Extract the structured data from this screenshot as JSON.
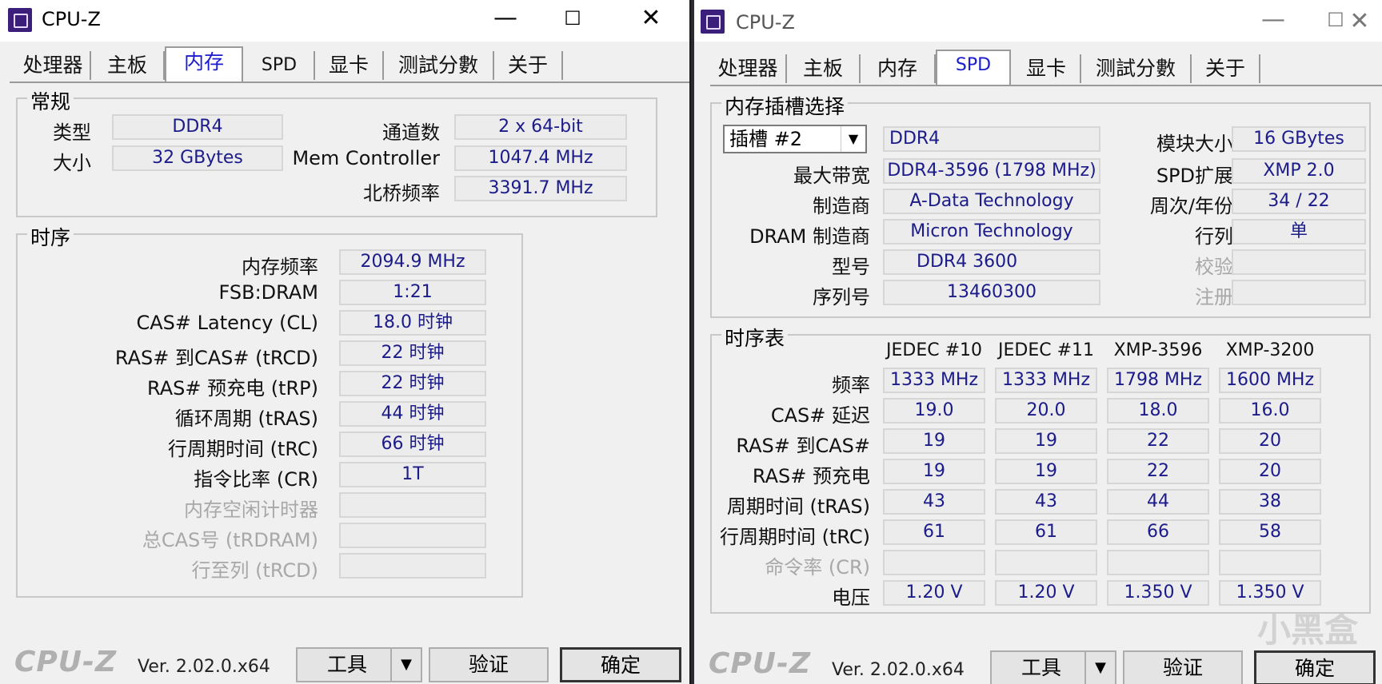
{
  "left": {
    "title": "CPU-Z",
    "controls": {
      "min": "—",
      "max": "☐",
      "close": "✕"
    },
    "tabs": [
      "处理器",
      "主板",
      "内存",
      "SPD",
      "显卡",
      "测試分數",
      "关于"
    ],
    "active_tab": "内存",
    "general": {
      "label": "常规",
      "type_label": "类型",
      "type_value": "DDR4",
      "size_label": "大小",
      "size_value": "32 GBytes",
      "channels_label": "通道数",
      "channels_value": "2 x 64-bit",
      "mc_label": "Mem Controller",
      "mc_value": "1047.4 MHz",
      "nb_label": "北桥频率",
      "nb_value": "3391.7 MHz"
    },
    "timings": {
      "label": "时序",
      "rows": [
        {
          "label": "内存频率",
          "value": "2094.9 MHz"
        },
        {
          "label": "FSB:DRAM",
          "value": "1:21"
        },
        {
          "label": "CAS# Latency (CL)",
          "value": "18.0 时钟"
        },
        {
          "label": "RAS# 到CAS# (tRCD)",
          "value": "22 时钟"
        },
        {
          "label": "RAS# 预充电 (tRP)",
          "value": "22 时钟"
        },
        {
          "label": "循环周期 (tRAS)",
          "value": "44 时钟"
        },
        {
          "label": "行周期时间 (tRC)",
          "value": "66 时钟"
        },
        {
          "label": "指令比率 (CR)",
          "value": "1T"
        },
        {
          "label": "内存空闲计时器",
          "value": ""
        },
        {
          "label": "总CAS号 (tRDRAM)",
          "value": ""
        },
        {
          "label": "行至列 (tRCD)",
          "value": ""
        }
      ]
    },
    "footer": {
      "logo": "CPU-Z",
      "version": "Ver. 2.02.0.x64",
      "tools": "工具",
      "validate": "验证",
      "ok": "确定",
      "dropdown": "▼"
    }
  },
  "right": {
    "title": "CPU-Z",
    "controls": {
      "min": "—",
      "max": "☐",
      "close": "✕"
    },
    "tabs": [
      "处理器",
      "主板",
      "内存",
      "SPD",
      "显卡",
      "测試分數",
      "关于"
    ],
    "active_tab": "SPD",
    "slot": {
      "label": "内存插槽选择",
      "slot_value": "插槽 #2",
      "type_value": "DDR4",
      "module_size_label": "模块大小",
      "module_size_value": "16 GBytes",
      "max_bw_label": "最大带宽",
      "max_bw_value": "DDR4-3596 (1798 MHz)",
      "spd_ext_label": "SPD扩展",
      "spd_ext_value": "XMP 2.0",
      "maker_label": "制造商",
      "maker_value": "A-Data Technology",
      "week_year_label": "周次/年份",
      "week_year_value": "34 / 22",
      "dram_maker_label": "DRAM 制造商",
      "dram_maker_value": "Micron Technology",
      "ranks_label": "行列",
      "ranks_value": "单",
      "part_label": "型号",
      "part_value": "DDR4 3600",
      "correction_label": "校验",
      "correction_value": "",
      "serial_label": "序列号",
      "serial_value": "13460300",
      "registered_label": "注册",
      "registered_value": ""
    },
    "timing_table": {
      "label": "时序表",
      "columns": [
        "JEDEC #10",
        "JEDEC #11",
        "XMP-3596",
        "XMP-3200"
      ],
      "rows": [
        {
          "label": "频率",
          "values": [
            "1333 MHz",
            "1333 MHz",
            "1798 MHz",
            "1600 MHz"
          ],
          "dim": false
        },
        {
          "label": "CAS# 延迟",
          "values": [
            "19.0",
            "20.0",
            "18.0",
            "16.0"
          ],
          "dim": false
        },
        {
          "label": "RAS# 到CAS#",
          "values": [
            "19",
            "19",
            "22",
            "20"
          ],
          "dim": false
        },
        {
          "label": "RAS# 预充电",
          "values": [
            "19",
            "19",
            "22",
            "20"
          ],
          "dim": false
        },
        {
          "label": "周期时间 (tRAS)",
          "values": [
            "43",
            "43",
            "44",
            "38"
          ],
          "dim": false
        },
        {
          "label": "行周期时间 (tRC)",
          "values": [
            "61",
            "61",
            "66",
            "58"
          ],
          "dim": false
        },
        {
          "label": "命令率 (CR)",
          "values": [
            "",
            "",
            "",
            ""
          ],
          "dim": true
        },
        {
          "label": "电压",
          "values": [
            "1.20 V",
            "1.20 V",
            "1.350 V",
            "1.350 V"
          ],
          "dim": false
        }
      ]
    },
    "footer": {
      "logo": "CPU-Z",
      "version": "Ver. 2.02.0.x64",
      "tools": "工具",
      "validate": "验证",
      "ok": "确定",
      "dropdown": "▼"
    },
    "watermark": "小黑盒"
  }
}
